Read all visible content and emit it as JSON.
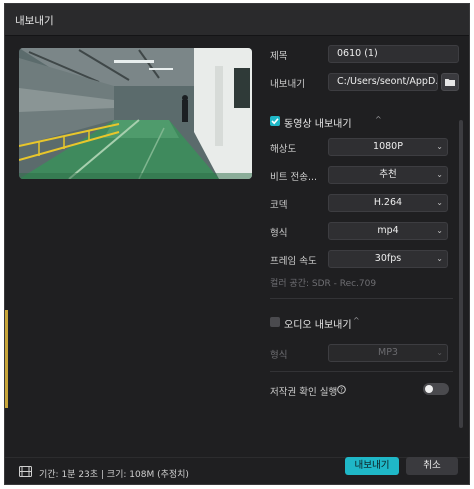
{
  "window": {
    "title": "내보내기"
  },
  "form": {
    "title_label": "제목",
    "title_value": "0610 (1)",
    "export_to_label": "내보내기",
    "export_path": "C:/Users/seont/AppD..."
  },
  "video": {
    "section_label": "동영상 내보내기",
    "enabled": true,
    "resolution_label": "해상도",
    "resolution_value": "1080P",
    "bitrate_label": "비트 전송...",
    "bitrate_value": "추천",
    "codec_label": "코덱",
    "codec_value": "H.264",
    "format_label": "형식",
    "format_value": "mp4",
    "framerate_label": "프레임 속도",
    "framerate_value": "30fps",
    "colorspace_text": "컬러 공간: SDR - Rec.709"
  },
  "audio": {
    "section_label": "오디오 내보내기",
    "enabled": false,
    "format_label": "형식",
    "format_value": "MP3"
  },
  "copyright": {
    "label": "저작권 확인 실행",
    "enabled": false
  },
  "footer": {
    "info": "기간: 1분 23초 | 크기: 108M (추정치)",
    "export_button": "내보내기",
    "cancel_button": "취소"
  },
  "colors": {
    "accent": "#1fb7c7",
    "background": "#1f1f21",
    "field": "#2f2f32"
  },
  "icons": {
    "folder": "folder-icon",
    "chevron": "chevron-down-icon",
    "check": "checkbox-check-icon",
    "info": "info-circle-icon",
    "film": "film-icon",
    "collapse": "chevron-up-icon"
  }
}
